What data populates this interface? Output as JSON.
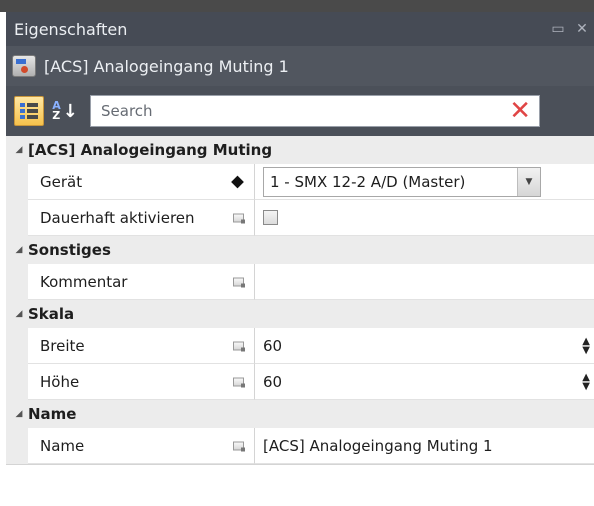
{
  "window": {
    "title": "Eigenschaften",
    "object_name": "[ACS] Analogeingang Muting 1"
  },
  "toolbar": {
    "search_placeholder": "Search"
  },
  "categories": [
    {
      "label": "[ACS] Analogeingang Muting",
      "rows": [
        {
          "name": "Gerät",
          "value": "1 - SMX 12-2 A/D (Master)",
          "editor": "combo"
        },
        {
          "name": "Dauerhaft aktivieren",
          "value": "",
          "editor": "checkbox"
        }
      ]
    },
    {
      "label": "Sonstiges",
      "rows": [
        {
          "name": "Kommentar",
          "value": "",
          "editor": "text"
        }
      ]
    },
    {
      "label": "Skala",
      "rows": [
        {
          "name": "Breite",
          "value": "60",
          "editor": "spin"
        },
        {
          "name": "Höhe",
          "value": "60",
          "editor": "spin"
        }
      ]
    },
    {
      "label": "Name",
      "rows": [
        {
          "name": "Name",
          "value": "[ACS] Analogeingang Muting 1",
          "editor": "text"
        }
      ]
    }
  ],
  "colors": {
    "titlebar_bg": "#464b55",
    "category_bg": "#ececec",
    "clear_icon": "#e04545",
    "active_tool": "#f6c24c"
  }
}
